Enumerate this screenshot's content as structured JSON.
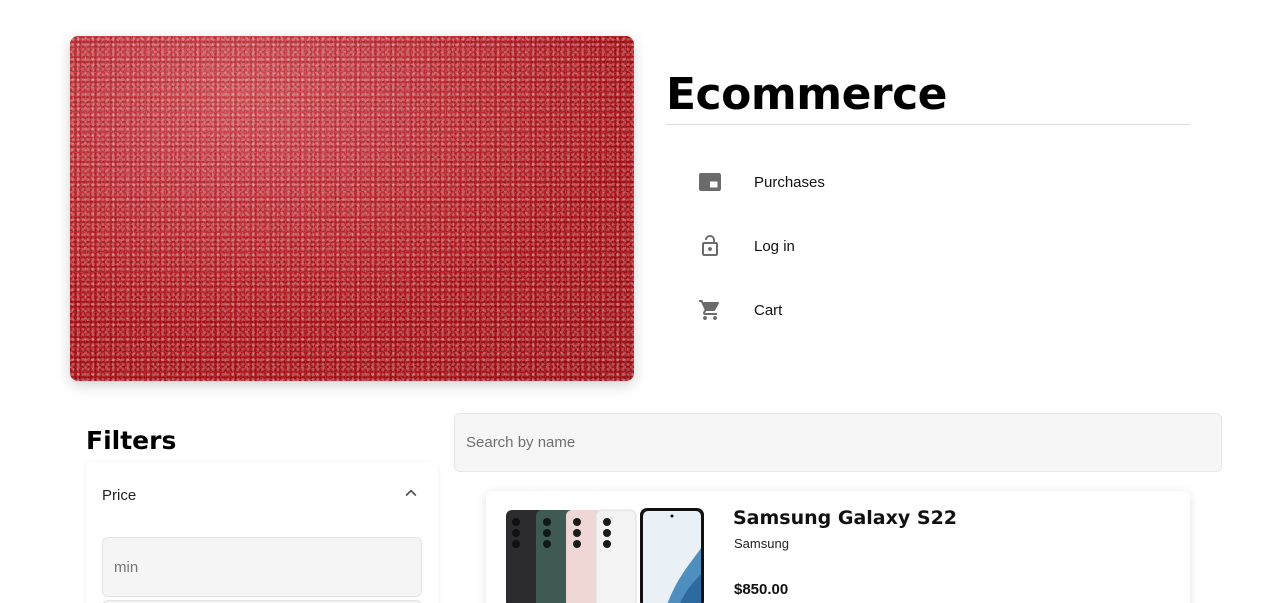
{
  "header": {
    "title": "Ecommerce",
    "hero_image": "red-glitter-texture"
  },
  "nav": {
    "items": [
      {
        "label": "Purchases",
        "icon": "picture-in-picture-icon"
      },
      {
        "label": "Log in",
        "icon": "lock-open-icon"
      },
      {
        "label": "Cart",
        "icon": "shopping-cart-icon"
      }
    ]
  },
  "filters": {
    "title": "Filters",
    "price": {
      "label": "Price",
      "expanded": true,
      "min_placeholder": "min"
    }
  },
  "search": {
    "placeholder": "Search by name"
  },
  "products": [
    {
      "name": "Samsung Galaxy S22",
      "brand": "Samsung",
      "price": "$850.00",
      "image": "samsung-galaxy-s22-phones"
    }
  ],
  "colors": {
    "hero_red": "#c4121c",
    "icon_gray": "#6b6b6b",
    "input_bg": "#f5f5f5"
  }
}
